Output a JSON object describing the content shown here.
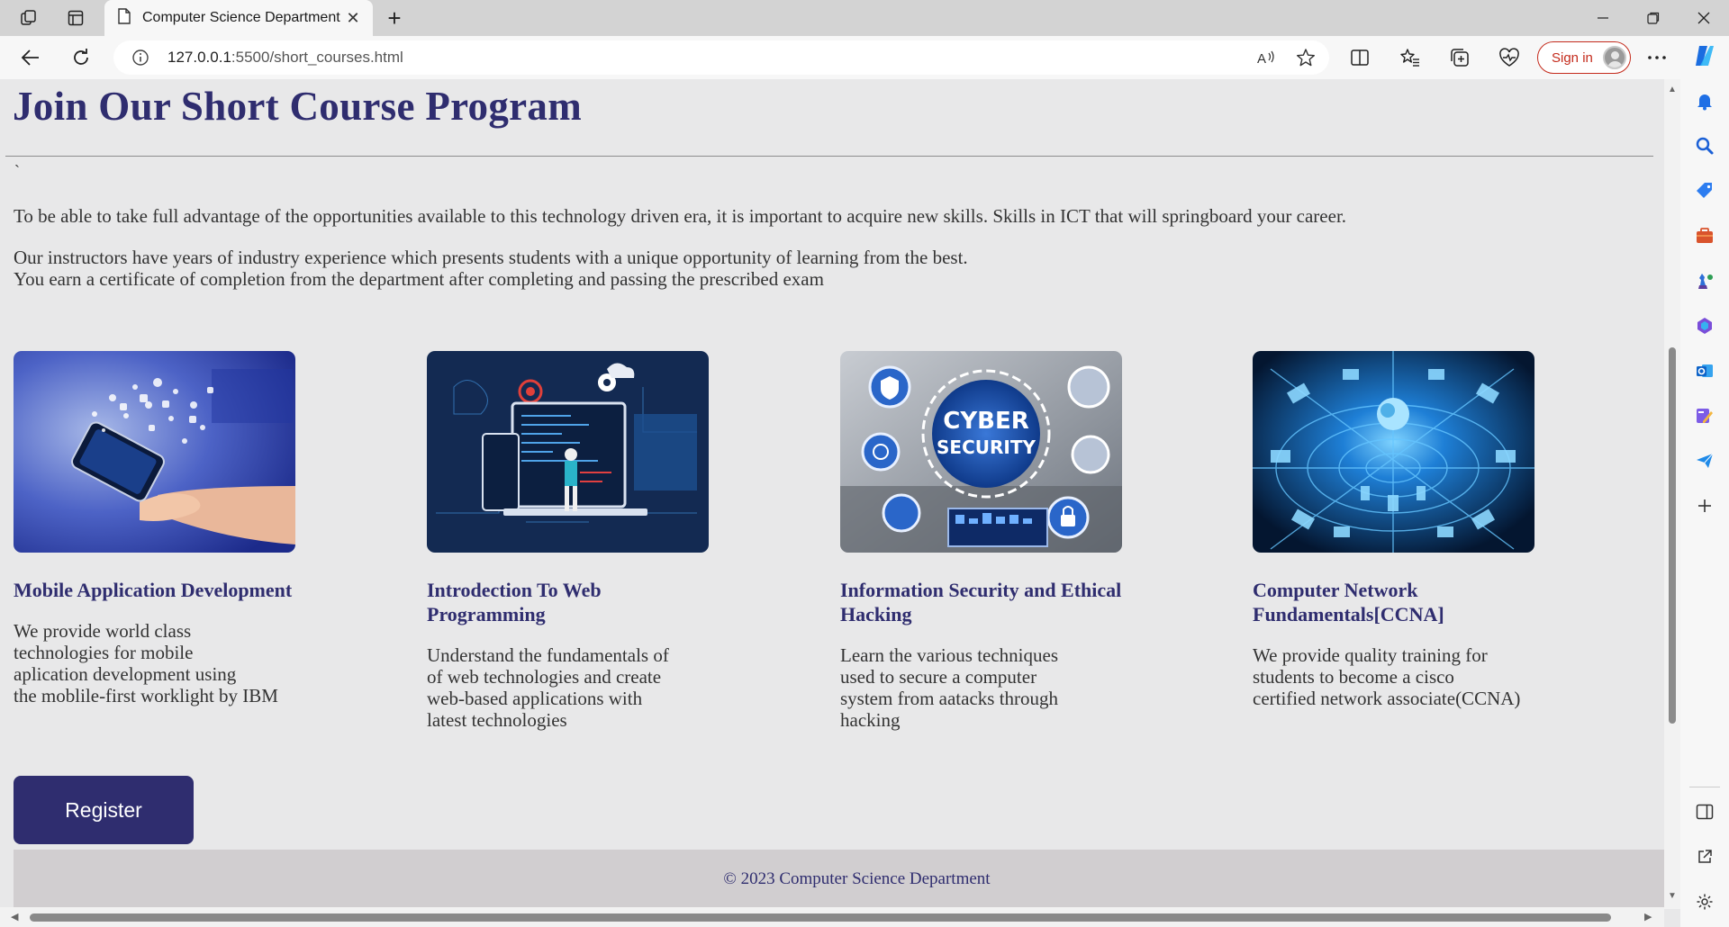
{
  "browser": {
    "tab_title": "Computer Science Department",
    "url_host": "127.0.0.1",
    "url_rest": ":5500/short_courses.html",
    "sign_in_label": "Sign in"
  },
  "page": {
    "heading": "Join Our Short Course Program",
    "backtick": "`",
    "intro": "To be able to take full advantage of the opportunities available to this technology driven era, it is important to acquire new skills. Skills in ICT that will springboard your career.",
    "instructors_line1": "Our instructors have years of industry experience which presents students with a unique opportunity of learning from the best.",
    "instructors_line2": "You earn a certificate of completion from the department after completing and passing the prescribed exam",
    "courses": [
      {
        "title": "Mobile Application Development",
        "description": "We provide world class\ntechnologies for mobile\naplication development using\nthe moblile-first worklight by IBM"
      },
      {
        "title": "Introdection To Web Programming",
        "description": "Understand the fundamentals of\nof web technologies and create\nweb-based applications with\nlatest technologies"
      },
      {
        "title": "Information Security and Ethical Hacking",
        "description": "Learn the various techniques\nused to secure a computer\nsystem from aatacks through\nhacking",
        "image_text_1": "CYBER",
        "image_text_2": "SECURITY"
      },
      {
        "title": "Computer Network Fundamentals[CCNA]",
        "description": "We provide quality training for\nstudents to become a cisco\ncertified network associate(CCNA)"
      }
    ],
    "register_label": "Register",
    "footer": "© 2023 Computer Science Department"
  }
}
